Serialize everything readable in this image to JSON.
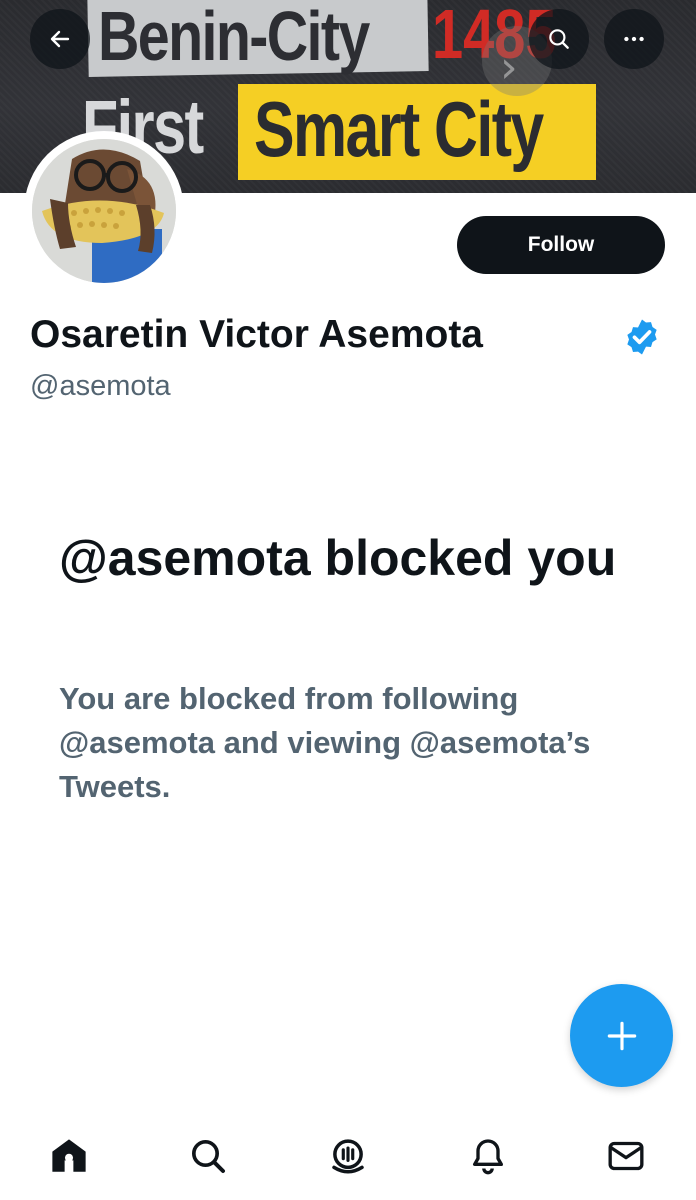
{
  "banner": {
    "line1": "Benin-City",
    "year": "1485",
    "line2_first": "First",
    "line2_smart": "Smart City"
  },
  "top_nav": {
    "back_icon": "arrow-left-icon",
    "search_icon": "search-icon",
    "more_icon": "more-horizontal-icon"
  },
  "profile": {
    "follow_label": "Follow",
    "display_name": "Osaretin Victor Asemota",
    "verified_icon": "verified-badge-icon",
    "handle": "@asemota"
  },
  "blocked": {
    "title": "@asemota blocked you",
    "description": "You are blocked from following @asemota and viewing @asemota’s Tweets."
  },
  "fab": {
    "icon": "plus-icon"
  },
  "bottom_nav": {
    "items": [
      "home-icon",
      "search-icon",
      "spaces-icon",
      "notifications-icon",
      "messages-icon"
    ]
  },
  "colors": {
    "accent": "#1d9bf0",
    "text_primary": "#0f1419",
    "text_secondary": "#536471",
    "banner_yellow": "#f5cf24",
    "banner_red": "#d12b25"
  }
}
